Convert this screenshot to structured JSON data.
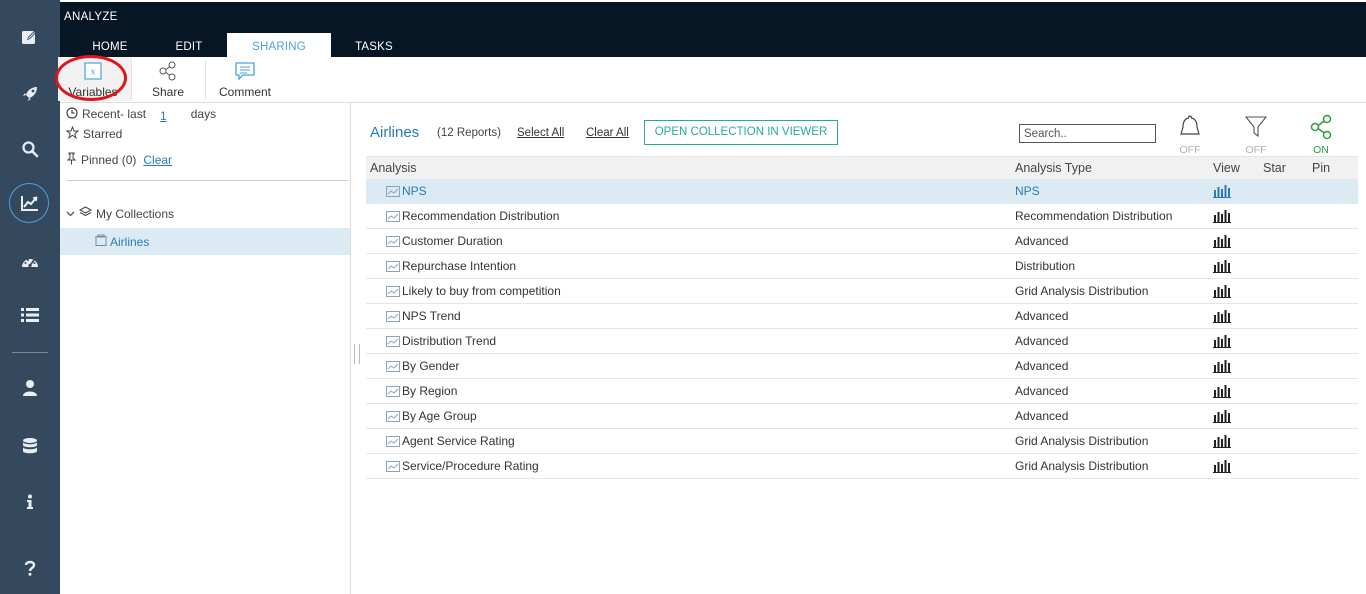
{
  "app": {
    "title": "ANALYZE"
  },
  "tabs": [
    {
      "label": "HOME"
    },
    {
      "label": "EDIT"
    },
    {
      "label": "SHARING"
    },
    {
      "label": "TASKS"
    }
  ],
  "active_tab": "SHARING",
  "ribbon": {
    "variables_label": "Variables",
    "share_label": "Share",
    "comment_label": "Comment"
  },
  "sidebar_icons": [
    "pencil-edit-icon",
    "rocket-icon",
    "search-icon",
    "trend-chart-icon",
    "dashboard-gauge-icon",
    "list-icon",
    "user-icon",
    "database-icon",
    "info-icon",
    "help-icon"
  ],
  "left_panel": {
    "recent_label": "Recent- last",
    "recent_days_value": "1",
    "days_label": "days",
    "starred_label": "Starred",
    "pinned_label": "Pinned (0)",
    "clear_label": "Clear",
    "my_collections_label": "My Collections",
    "collection_item": "Airlines"
  },
  "main": {
    "collection_name": "Airlines",
    "report_count": "(12 Reports)",
    "select_all": "Select All",
    "clear_all": "Clear All",
    "open_viewer": "OPEN COLLECTION IN VIEWER",
    "search_placeholder": "Search..",
    "tools": [
      {
        "icon": "bell-icon",
        "label": "OFF",
        "color": "#aab2b9"
      },
      {
        "icon": "filter-icon",
        "label": "OFF",
        "color": "#aab2b9"
      },
      {
        "icon": "share-icon",
        "label": "ON",
        "color": "#2e9e3e"
      }
    ]
  },
  "table": {
    "headers": {
      "analysis": "Analysis",
      "type": "Analysis Type",
      "view": "View",
      "star": "Star",
      "pin": "Pin"
    },
    "rows": [
      {
        "name": "NPS",
        "type": "NPS"
      },
      {
        "name": "Recommendation Distribution",
        "type": "Recommendation Distribution"
      },
      {
        "name": "Customer Duration",
        "type": "Advanced"
      },
      {
        "name": "Repurchase Intention",
        "type": "Distribution"
      },
      {
        "name": "Likely to buy from competition",
        "type": "Grid Analysis Distribution"
      },
      {
        "name": "NPS Trend",
        "type": "Advanced"
      },
      {
        "name": "Distribution Trend",
        "type": "Advanced"
      },
      {
        "name": "By Gender",
        "type": "Advanced"
      },
      {
        "name": "By Region",
        "type": "Advanced"
      },
      {
        "name": "By Age Group",
        "type": "Advanced"
      },
      {
        "name": "Agent Service Rating",
        "type": "Grid Analysis Distribution"
      },
      {
        "name": "Service/Procedure Rating",
        "type": "Grid Analysis Distribution"
      }
    ]
  },
  "colors": {
    "rail": "#34495e",
    "topbar": "#061624",
    "accent": "#2a7ab8",
    "teal": "#2aa89a",
    "highlight": "#e0141b"
  }
}
